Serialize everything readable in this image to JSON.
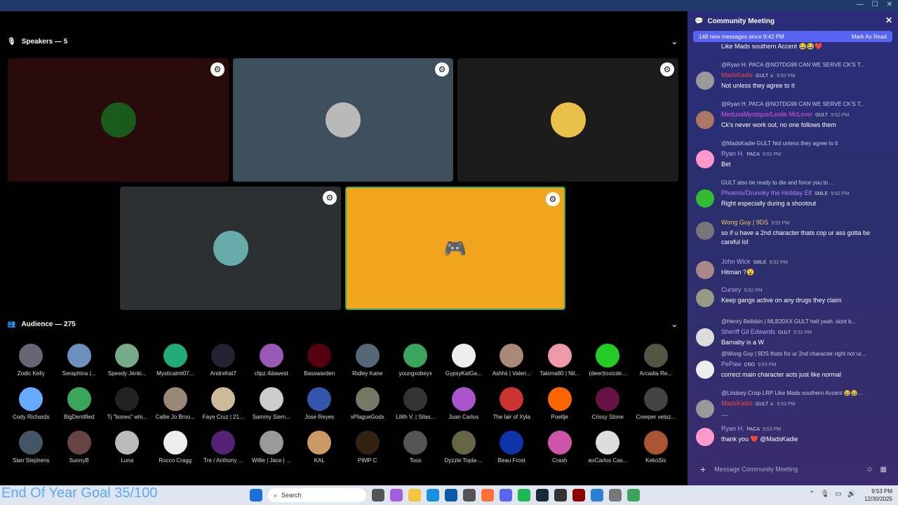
{
  "speakers_label": "Speakers — 5",
  "audience_label": "Audience — 275",
  "speakers": [
    {
      "color": "#2a0b0b",
      "avatar": "#1a5a1a"
    },
    {
      "color": "#3f4e5d",
      "avatar": "#b9b9b9"
    },
    {
      "color": "#1b1b1b",
      "avatar": "#e8c04a"
    },
    {
      "color": "#2c3033",
      "avatar": "#6aa"
    },
    {
      "color": "#f1a41e",
      "avatar": "discord-logo"
    }
  ],
  "audience": [
    {
      "name": "Zodic Kelly",
      "color": "#667"
    },
    {
      "name": "Seraphina (...",
      "color": "#6b8fbf"
    },
    {
      "name": "Speedy Jenki...",
      "color": "#7a8"
    },
    {
      "name": "Mysticalmt07...",
      "color": "#2a7"
    },
    {
      "name": "Andrefrat7",
      "color": "#223"
    },
    {
      "name": "clipz.4dawest",
      "color": "#9b59b6"
    },
    {
      "name": "Basswarden",
      "color": "#501"
    },
    {
      "name": "Ridley Kane",
      "color": "#567"
    },
    {
      "name": "youngxobeyx",
      "color": "#3ba55c"
    },
    {
      "name": "GypsyKatGa...",
      "color": "#eee"
    },
    {
      "name": "Ashhii | Valeri...",
      "color": "#a87"
    },
    {
      "name": "Takima80 | Nil...",
      "color": "#e9a"
    },
    {
      "name": "(deer)toxicde...",
      "color": "#2c2"
    },
    {
      "name": "Arcadia Re...",
      "color": "#554"
    },
    {
      "name": "Cody Richards",
      "color": "#6af"
    },
    {
      "name": "BigDentified",
      "color": "#3ba55c"
    },
    {
      "name": "Tj \"bones\" whi...",
      "color": "#222"
    },
    {
      "name": "Callie Jo Broo...",
      "color": "#987"
    },
    {
      "name": "Faye Cruz | 21...",
      "color": "#cb9"
    },
    {
      "name": "Sammy Siem...",
      "color": "#ccc"
    },
    {
      "name": "Jose Reyes",
      "color": "#35a"
    },
    {
      "name": "xPlagueGodx",
      "color": "#776"
    },
    {
      "name": "Lilith V. | Silas...",
      "color": "#333"
    },
    {
      "name": "Juan Carlos",
      "color": "#a5c"
    },
    {
      "name": "The lair of Xyla",
      "color": "#c33"
    },
    {
      "name": "Poeltje",
      "color": "#f60"
    },
    {
      "name": "Crissy Stone",
      "color": "#614"
    },
    {
      "name": "Creeper velaz...",
      "color": "#444"
    },
    {
      "name": "Stan Stephens",
      "color": "#456"
    },
    {
      "name": "SunnyB",
      "color": "#644"
    },
    {
      "name": "Luna",
      "color": "#bbb"
    },
    {
      "name": "Rocco Cragg",
      "color": "#eee"
    },
    {
      "name": "Tre / Anthony ...",
      "color": "#527"
    },
    {
      "name": "Willie | Jace | ...",
      "color": "#999"
    },
    {
      "name": "KAL",
      "color": "#c96"
    },
    {
      "name": "PIMP C",
      "color": "#321"
    },
    {
      "name": "Toos",
      "color": "#555"
    },
    {
      "name": "Dyzzle Topla-...",
      "color": "#664"
    },
    {
      "name": "Beau Frost",
      "color": "#13a"
    },
    {
      "name": "Crash",
      "color": "#c5a"
    },
    {
      "name": "ʍxCarlos Cas...",
      "color": "#ddd"
    },
    {
      "name": "KekoSix",
      "color": "#a53"
    }
  ],
  "goal_text": "End Of Year Goal 35/100",
  "panel": {
    "title": "Community Meeting",
    "new_messages": "148 new messages since 9:42 PM",
    "mark_read": "Mark As Read",
    "composer_placeholder": "Message Community Meeting"
  },
  "messages": [
    {
      "reply": "",
      "author": "",
      "tag": "",
      "time": "",
      "text": "Like Mads southern Accent 😂😂❤️",
      "author_color": "#fff",
      "av": "#b88"
    },
    {
      "reply": "@Ryan H.  PACA  @NOTDG99 CAN WE SERVE CK'S T...",
      "author": "MadsKadie",
      "tag": "GULT ⚔",
      "time": "9:52 PM",
      "text": "Not unless they agree to it",
      "author_color": "#f04747",
      "av": "#999"
    },
    {
      "reply": "@Ryan H.  PACA  @NOTDG99 CAN WE SERVE CK'S T...",
      "author": "MedusaMystique/Leslie McLovin",
      "tag": "GULT",
      "time": "9:52 PM",
      "text": "Ck's never work out, no one follows them",
      "author_color": "#e255e2",
      "av": "#a76"
    },
    {
      "reply": "@MadsKadie  GULT  Not unless they agree to it",
      "author": "Ryan H.",
      "tag": "PACA",
      "time": "9:52 PM",
      "text": "Bet",
      "author_color": "#b9a3f5",
      "av": "#f9c"
    },
    {
      "reply": "GULT  also be ready to die and force you to ...",
      "author": "Phoenix/Drunnky the Holiday Elf",
      "tag": "SMLE",
      "time": "9:52 PM",
      "text": "Right especially during a shootout",
      "author_color": "#c07dff",
      "av": "#3b3"
    },
    {
      "reply": "",
      "author": "Wong Guy | 9DS",
      "tag": "",
      "time": "9:52 PM",
      "text": "so if u have a 2nd character thats cop ur ass gotta be careful lol",
      "author_color": "#f5c26b",
      "av": "#777"
    },
    {
      "reply": "",
      "author": "John Wick",
      "tag": "SMLE",
      "time": "9:52 PM",
      "text": "Hitman ?😮",
      "author_color": "#b9a3f5",
      "av": "#a88"
    },
    {
      "reply": "",
      "author": "Cursey",
      "tag": "",
      "time": "9:52 PM",
      "text": "Keep gangs active on any drugs they claim",
      "author_color": "#b9a3f5",
      "av": "#998"
    },
    {
      "reply": "@Henry Bellskin | MLB20XX  GULT  hell yeah. dont b...",
      "author": "Sheriff Gil Edwards",
      "tag": "GULT",
      "time": "9:52 PM",
      "text": "Barnaby is a W",
      "author_color": "#b9a3f5",
      "av": "#ddd"
    },
    {
      "reply": "@Wong Guy | 9DS  thats for ur 2nd character right not ur...",
      "author": "PePaw",
      "tag": "CRO",
      "time": "9:53 PM",
      "text": "correct main character acts just like normal",
      "author_color": "#b9a3f5",
      "av": "#eee"
    },
    {
      "reply": "@Lindsey Crisp  LRP  Like Mads southern Accent 😂😂...",
      "author": "MadsKadie",
      "tag": "GULT ⚔",
      "time": "9:53 PM",
      "text": "....",
      "author_color": "#f04747",
      "av": "#999"
    },
    {
      "reply": "",
      "author": "Ryan H.",
      "tag": "PACA",
      "time": "9:53 PM",
      "text": "thank you ❤️ @MadsKadie",
      "author_color": "#b9a3f5",
      "av": "#f9c"
    }
  ],
  "taskbar": {
    "search": "Search",
    "time": "9:53 PM",
    "date": "12/30/2025"
  }
}
